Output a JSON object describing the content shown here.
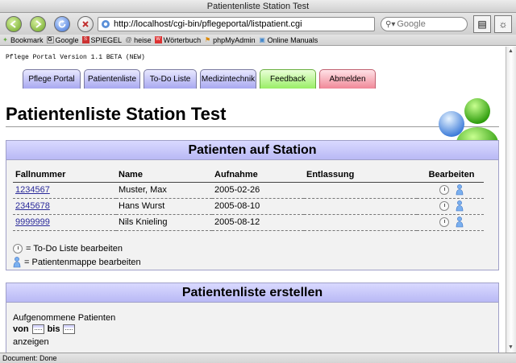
{
  "window": {
    "title": "Patientenliste Station Test"
  },
  "toolbar": {
    "url": "http://localhost/cgi-bin/pflegeportal/listpatient.cgi",
    "search_placeholder": "Google"
  },
  "bookmarks": [
    {
      "label": "Bookmark",
      "icon": "bookmark-icon"
    },
    {
      "label": "Google",
      "icon": "google-icon"
    },
    {
      "label": "SPIEGEL",
      "icon": "spiegel-icon"
    },
    {
      "label": "heise",
      "icon": "heise-icon"
    },
    {
      "label": "Wörterbuch",
      "icon": "dictionary-icon"
    },
    {
      "label": "phpMyAdmin",
      "icon": "phpmyadmin-icon"
    },
    {
      "label": "Online Manuals",
      "icon": "folder-icon"
    }
  ],
  "page": {
    "version": "Pflege Portal Version 1.1 BETA (NEW)",
    "title": "Patientenliste Station Test",
    "tabs": [
      {
        "label": "Pflege Portal",
        "color": "#b0b0f0"
      },
      {
        "label": "Patientenliste",
        "color": "#b0b0f0"
      },
      {
        "label": "To-Do Liste",
        "color": "#b0b0f0"
      },
      {
        "label": "Medizintechnik",
        "color": "#b0b0f0"
      },
      {
        "label": "Feedback",
        "color": "#99ee66"
      },
      {
        "label": "Abmelden",
        "color": "#f08898"
      }
    ]
  },
  "patients_panel": {
    "heading": "Patienten auf Station",
    "columns": [
      "Fallnummer",
      "Name",
      "Aufnahme",
      "Entlassung",
      "Bearbeiten"
    ],
    "rows": [
      {
        "id": "1234567",
        "name": "Muster, Max",
        "admitted": "2005-02-26",
        "discharged": ""
      },
      {
        "id": "2345678",
        "name": "Hans Wurst",
        "admitted": "2005-08-10",
        "discharged": ""
      },
      {
        "id": "9999999",
        "name": "Nils Knieling",
        "admitted": "2005-08-12",
        "discharged": ""
      }
    ],
    "legend_todo": "= To-Do Liste bearbeiten",
    "legend_folder": "= Patientenmappe bearbeiten"
  },
  "create_panel": {
    "heading": "Patientenliste erstellen",
    "line1": "Aufgenommene Patienten",
    "from_label": "von",
    "to_label": "bis",
    "show_label": "anzeigen"
  },
  "status": {
    "text": "Document: Done"
  }
}
